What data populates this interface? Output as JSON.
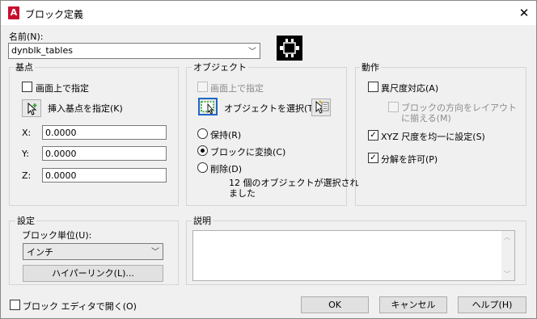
{
  "window": {
    "title": "ブロック定義",
    "app_icon": "A"
  },
  "name": {
    "label": "名前(N):",
    "value": "dynblk_tables"
  },
  "base_point": {
    "title": "基点",
    "specify_on_screen": "画面上で指定",
    "pick_button_label": "挿入基点を指定(K)",
    "x_label": "X:",
    "x_value": "0.0000",
    "y_label": "Y:",
    "y_value": "0.0000",
    "z_label": "Z:",
    "z_value": "0.0000"
  },
  "objects": {
    "title": "オブジェクト",
    "specify_on_screen": "画面上で指定",
    "select_label": "オブジェクトを選択(T)",
    "retain": "保持(R)",
    "convert": "ブロックに変換(C)",
    "delete": "削除(D)",
    "status_line1": "12 個のオブジェクトが選択され",
    "status_line2": "ました"
  },
  "behavior": {
    "title": "動作",
    "annotative": "異尺度対応(A)",
    "match_orientation_line1": "ブロックの方向をレイアウト",
    "match_orientation_line2": "に揃える(M)",
    "scale_uniformly": "XYZ 尺度を均一に設定(S)",
    "allow_exploding": "分解を許可(P)"
  },
  "settings": {
    "title": "設定",
    "units_label": "ブロック単位(U):",
    "units_value": "インチ",
    "hyperlink_button": "ハイパーリンク(L)..."
  },
  "description": {
    "title": "説明"
  },
  "footer": {
    "open_in_editor": "ブロック エディタで開く(O)",
    "ok": "OK",
    "cancel": "キャンセル",
    "help": "ヘルプ(H)"
  }
}
